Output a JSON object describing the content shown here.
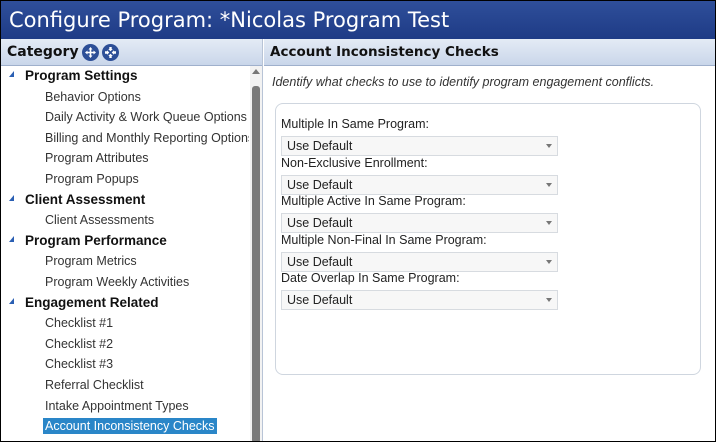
{
  "window": {
    "title": "Configure Program: *Nicolas Program Test"
  },
  "left": {
    "header": "Category",
    "tools": [
      "expand-all-icon",
      "collapse-all-icon"
    ],
    "tree": [
      {
        "type": "group",
        "label": "Program Settings"
      },
      {
        "type": "item",
        "label": "Behavior Options"
      },
      {
        "type": "item",
        "label": "Daily Activity & Work Queue Options"
      },
      {
        "type": "item",
        "label": "Billing and Monthly Reporting Options"
      },
      {
        "type": "item",
        "label": "Program Attributes"
      },
      {
        "type": "item",
        "label": "Program Popups"
      },
      {
        "type": "group",
        "label": "Client Assessment"
      },
      {
        "type": "item",
        "label": "Client Assessments"
      },
      {
        "type": "group",
        "label": "Program Performance"
      },
      {
        "type": "item",
        "label": "Program Metrics"
      },
      {
        "type": "item",
        "label": "Program Weekly Activities"
      },
      {
        "type": "group",
        "label": "Engagement Related"
      },
      {
        "type": "item",
        "label": "Checklist #1"
      },
      {
        "type": "item",
        "label": "Checklist #2"
      },
      {
        "type": "item",
        "label": "Checklist #3"
      },
      {
        "type": "item",
        "label": "Referral Checklist"
      },
      {
        "type": "item",
        "label": "Intake Appointment Types"
      },
      {
        "type": "item",
        "label": "Account Inconsistency Checks",
        "selected": true
      }
    ]
  },
  "right": {
    "header": "Account Inconsistency Checks",
    "description": "Identify what checks to use to identify program engagement conflicts.",
    "fields": [
      {
        "label": "Multiple In Same Program:",
        "value": "Use Default"
      },
      {
        "label": "Non-Exclusive Enrollment:",
        "value": "Use Default"
      },
      {
        "label": "Multiple Active In Same Program:",
        "value": "Use Default"
      },
      {
        "label": "Multiple Non-Final In Same Program:",
        "value": "Use Default"
      },
      {
        "label": "Date Overlap In Same Program:",
        "value": "Use Default"
      }
    ]
  },
  "colors": {
    "titlebar": "#1e3b86",
    "selection": "#2a86c8",
    "tree_arrow": "#2a5fb3"
  }
}
